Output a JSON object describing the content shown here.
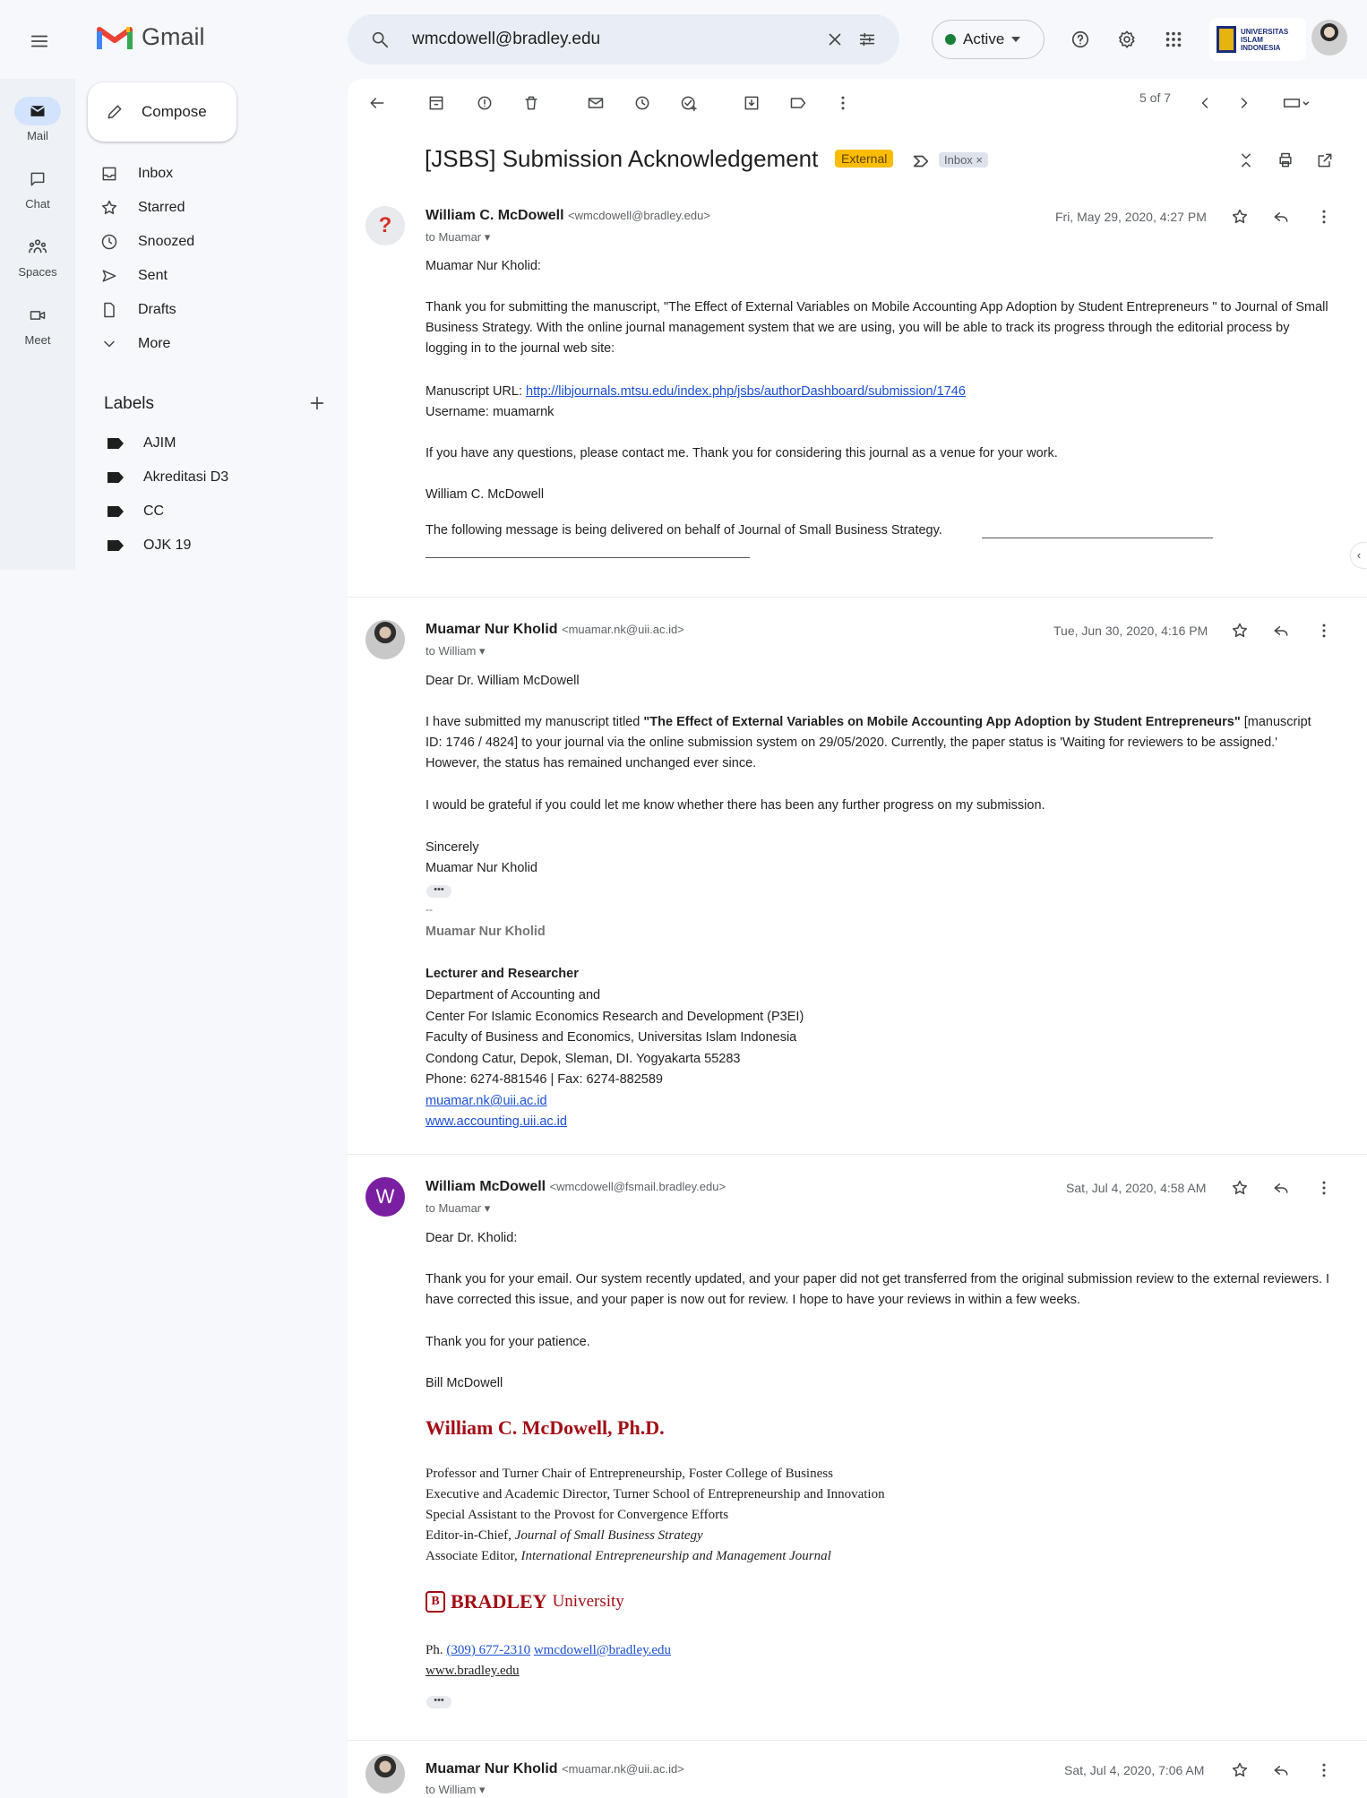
{
  "app": {
    "name": "Gmail"
  },
  "search": {
    "value": "wmcdowell@bradley.edu"
  },
  "status": {
    "label": "Active"
  },
  "org": {
    "line1": "UNIVERSITAS",
    "line2": "ISLAM",
    "line3": "INDONESIA"
  },
  "rail": [
    {
      "label": "Mail",
      "icon": "mail-icon"
    },
    {
      "label": "Chat",
      "icon": "chat-icon"
    },
    {
      "label": "Spaces",
      "icon": "spaces-icon"
    },
    {
      "label": "Meet",
      "icon": "meet-icon"
    }
  ],
  "compose": {
    "label": "Compose"
  },
  "nav": [
    {
      "label": "Inbox",
      "icon": "inbox-icon"
    },
    {
      "label": "Starred",
      "icon": "star-icon"
    },
    {
      "label": "Snoozed",
      "icon": "clock-icon"
    },
    {
      "label": "Sent",
      "icon": "send-icon"
    },
    {
      "label": "Drafts",
      "icon": "draft-icon"
    },
    {
      "label": "More",
      "icon": "chevron-down-icon"
    }
  ],
  "labels": {
    "title": "Labels",
    "items": [
      "AJIM",
      "Akreditasi D3",
      "CC",
      "OJK 19"
    ]
  },
  "thread": {
    "pager": "5 of 7",
    "subject": "[JSBS] Submission Acknowledgement",
    "badge_external": "External",
    "badge_inbox": "Inbox ×"
  },
  "messages": [
    {
      "sender": "William C. McDowell",
      "email": "<wmcdowell@bradley.edu>",
      "to": "to Muamar",
      "date": "Fri, May 29, 2020, 4:27 PM",
      "greeting": "Muamar Nur Kholid:",
      "p1": "Thank you for submitting the manuscript, \"The Effect of External Variables on Mobile Accounting App Adoption by Student Entrepreneurs \" to Journal of Small Business Strategy. With the online journal management system that we are using, you will be able to track its progress through the editorial process by logging in to the journal web site:",
      "url_label": "Manuscript URL: ",
      "url": "http://libjournals.mtsu.edu/index.php/jsbs/authorDashboard/submission/1746",
      "username": "Username: muamarnk",
      "p2": "If you have any questions, please contact me. Thank you for considering this journal as a venue for your work.",
      "signoff": "William C. McDowell",
      "footer": "The following message is being delivered on behalf of Journal of Small Business Strategy."
    },
    {
      "sender": "Muamar Nur Kholid",
      "email": "<muamar.nk@uii.ac.id>",
      "to": "to William",
      "date": "Tue, Jun 30, 2020, 4:16 PM",
      "greeting": "Dear Dr. William McDowell",
      "p1_start": "I have submitted my  manuscript titled  ",
      "p1_title": "\"The Effect of External Variables on Mobile Accounting App Adoption by Student Entrepreneurs\"",
      "p1_end": " [manuscript ID: 1746 / 4824] to your journal via the online submission system on 29/05/2020. Currently, the paper status is 'Waiting for reviewers to be assigned.' However, the status has remained unchanged ever since.",
      "p2": "I would be grateful if you could let me know whether there has been any further progress on my submission.",
      "closing": "Sincerely",
      "closing_name": "Muamar Nur Kholid",
      "dashes": "--",
      "sig_name": "Muamar Nur Kholid",
      "sig_title": "Lecturer and Researcher",
      "sig_lines": [
        "Department of Accounting and",
        "Center For Islamic Economics Research and Development (P3EI)",
        "Faculty of Business and Economics, Universitas Islam Indonesia",
        "Condong Catur, Depok, Sleman, DI. Yogyakarta 55283",
        "Phone: 6274-881546 | Fax: 6274-882589"
      ],
      "sig_email": "muamar.nk@uii.ac.id",
      "sig_web": "www.accounting.uii.ac.id"
    },
    {
      "sender": "William McDowell",
      "avatar_letter": "W",
      "email": "<wmcdowell@fsmail.bradley.edu>",
      "to": "to Muamar",
      "date": "Sat, Jul 4, 2020, 4:58 AM",
      "greeting": "Dear Dr. Kholid:",
      "p1": "Thank you for your email.  Our system recently updated, and your paper did not get transferred from the original submission review to the external reviewers.  I have corrected this issue, and your paper is now out for review.  I hope to have your reviews in within a few weeks.",
      "p2": "Thank you for your patience.",
      "signoff": "Bill McDowell",
      "sig_name": "William C. McDowell, Ph.D.",
      "sig_lines": [
        "Professor and Turner Chair of Entrepreneurship, Foster College of Business",
        "Executive and Academic Director, Turner School of Entrepreneurship and Innovation",
        "Special Assistant to the Provost for Convergence Efforts"
      ],
      "sig_editor_prefix": "Editor-in-Chief, ",
      "sig_editor_journal": "Journal of Small Business Strategy",
      "sig_assoc_prefix": "Associate Editor, ",
      "sig_assoc_journal": "International Entrepreneurship and Management Journal",
      "bradley_name": "BRADLEY",
      "bradley_univ": "University",
      "phone_prefix": "Ph. ",
      "phone": "(309) 677-2310",
      "sig_email": "wmcdowell@bradley.edu",
      "sig_web": "www.bradley.edu"
    },
    {
      "sender": "Muamar Nur Kholid",
      "email": "<muamar.nk@uii.ac.id>",
      "to": "to William",
      "date": "Sat, Jul 4, 2020, 7:06 AM"
    }
  ]
}
